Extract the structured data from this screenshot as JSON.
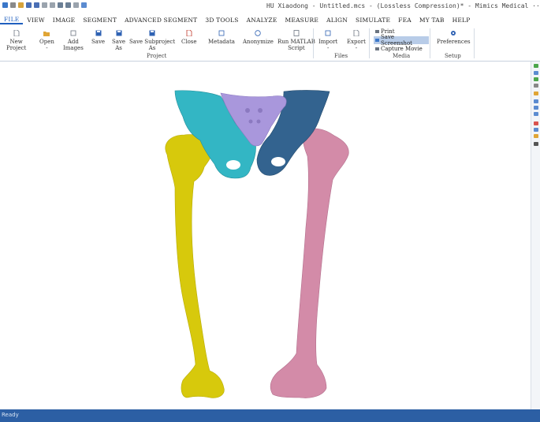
{
  "window": {
    "title": "HU Xiaodong - Untitled.mcs -  (Lossless Compression)* - Mimics Medical ···"
  },
  "menu": {
    "items": [
      "FILE",
      "VIEW",
      "IMAGE",
      "SEGMENT",
      "ADVANCED SEGMENT",
      "3D TOOLS",
      "ANALYZE",
      "MEASURE",
      "ALIGN",
      "SIMULATE",
      "FEA",
      "MY TAB",
      "HELP"
    ],
    "active": "FILE"
  },
  "ribbon": {
    "project": {
      "group_label": "Project",
      "new_project": "New\nProject",
      "open": "Open\n-",
      "add_images": "Add\nImages",
      "save": "Save",
      "save_as": "Save\nAs",
      "save_subproject_as": "Save Subproject\nAs",
      "close": "Close",
      "metadata": "Metadata",
      "anonymize": "Anonymize",
      "run_matlab_script": "Run MATLAB\nScript"
    },
    "files": {
      "group_label": "Files",
      "import": "Import\n-",
      "export": "Export\n-"
    },
    "media": {
      "group_label": "Media",
      "print": "Print",
      "save_screenshot": "Save Screenshot",
      "capture_movie": "Capture Movie"
    },
    "setup": {
      "group_label": "Setup",
      "preferences": "Preferences"
    }
  },
  "status": {
    "text": "Ready"
  },
  "colors": {
    "accent": "#1f5fbf",
    "status_bar": "#2c5fa4",
    "pelvis_left": "#33b6c4",
    "pelvis_right": "#33638f",
    "sacrum": "#a997dc",
    "femur_left": "#d7c90c",
    "femur_right": "#d38ba8"
  }
}
